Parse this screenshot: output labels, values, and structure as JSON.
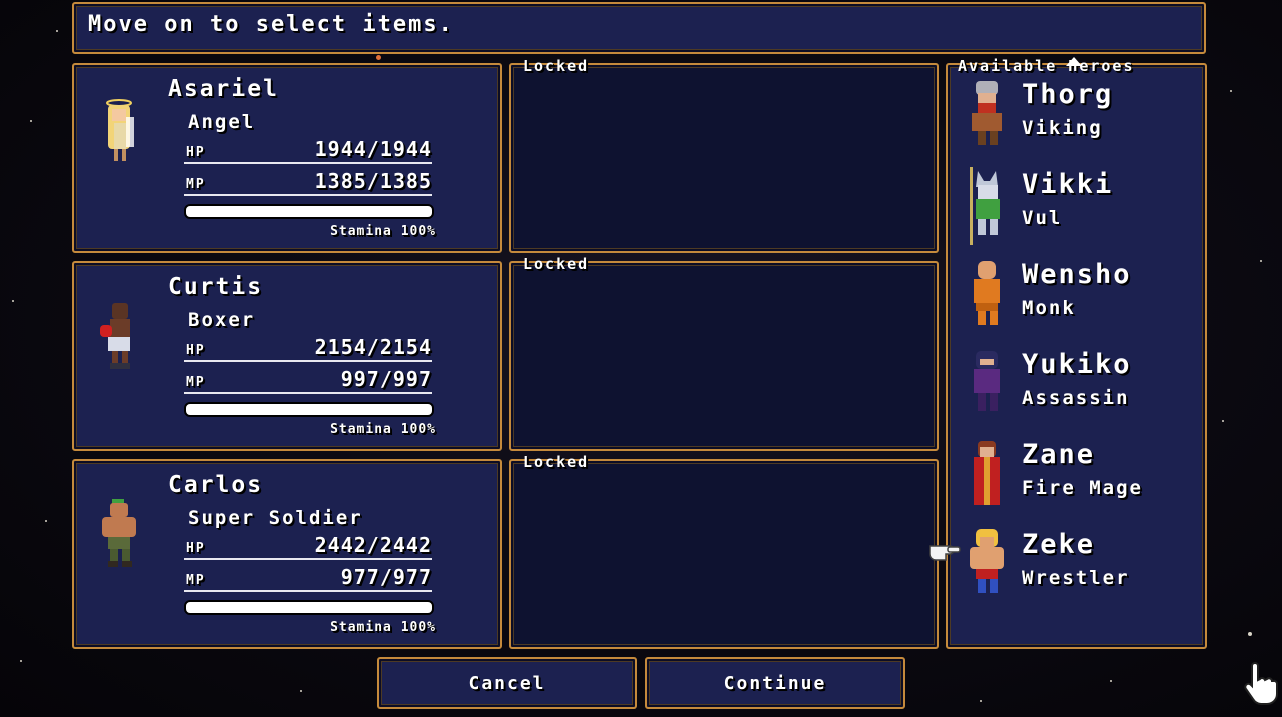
{
  "header": {
    "text": "Move on to select items."
  },
  "party": [
    {
      "name": "Asariel",
      "class": "Angel",
      "hp_label": "HP",
      "hp": "1944/1944",
      "mp_label": "MP",
      "mp": "1385/1385",
      "stamina_text": "Stamina 100%",
      "stamina_fraction": 1.0,
      "sprite": "angel-sprite-icon"
    },
    {
      "name": "Curtis",
      "class": "Boxer",
      "hp_label": "HP",
      "hp": "2154/2154",
      "mp_label": "MP",
      "mp": "997/997",
      "stamina_text": "Stamina 100%",
      "stamina_fraction": 1.0,
      "sprite": "boxer-sprite-icon"
    },
    {
      "name": "Carlos",
      "class": "Super Soldier",
      "hp_label": "HP",
      "hp": "2442/2442",
      "mp_label": "MP",
      "mp": "977/977",
      "stamina_text": "Stamina 100%",
      "stamina_fraction": 1.0,
      "sprite": "soldier-sprite-icon"
    }
  ],
  "slots": [
    {
      "label": "Locked"
    },
    {
      "label": "Locked"
    },
    {
      "label": "Locked"
    }
  ],
  "available": {
    "title": "Available Heroes",
    "heroes": [
      {
        "name": "Thorg",
        "class": "Viking",
        "sprite": "viking-sprite-icon"
      },
      {
        "name": "Vikki",
        "class": "Vul",
        "sprite": "vul-sprite-icon"
      },
      {
        "name": "Wensho",
        "class": "Monk",
        "sprite": "monk-sprite-icon"
      },
      {
        "name": "Yukiko",
        "class": "Assassin",
        "sprite": "assassin-sprite-icon"
      },
      {
        "name": "Zane",
        "class": "Fire Mage",
        "sprite": "fire-mage-sprite-icon"
      },
      {
        "name": "Zeke",
        "class": "Wrestler",
        "sprite": "wrestler-sprite-icon"
      }
    ],
    "selected_index": 5
  },
  "buttons": {
    "cancel": "Cancel",
    "continue": "Continue"
  },
  "colors": {
    "panel": "#1c2150",
    "border": "#c58a3c",
    "text": "#ffffff"
  }
}
